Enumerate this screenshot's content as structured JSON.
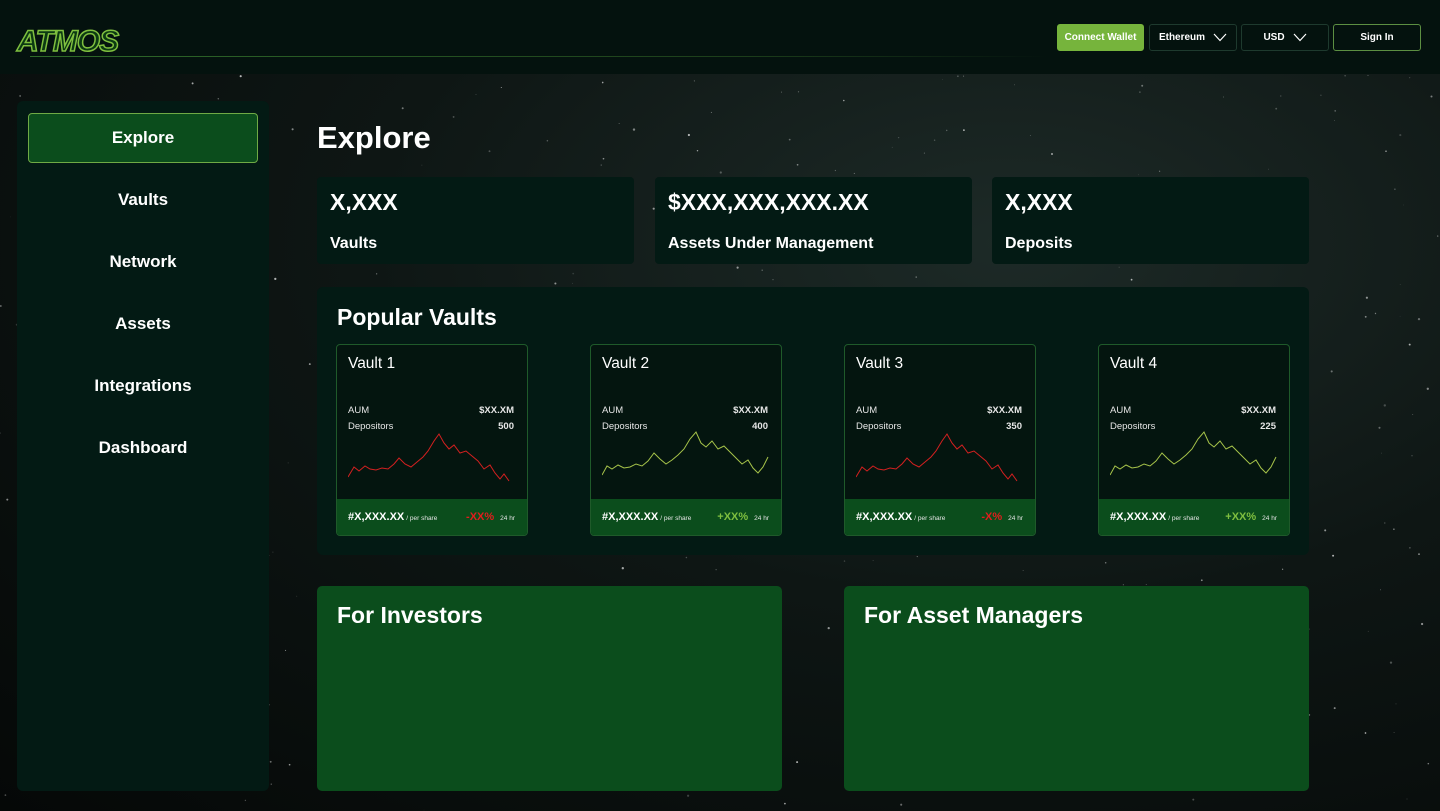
{
  "header": {
    "logo_text": "ATMOS",
    "connect_label": "Connect Wallet",
    "network": "Ethereum",
    "currency": "USD",
    "signin_label": "Sign In"
  },
  "sidebar": {
    "items": [
      {
        "label": "Explore",
        "active": true
      },
      {
        "label": "Vaults"
      },
      {
        "label": "Network"
      },
      {
        "label": "Assets"
      },
      {
        "label": "Integrations"
      },
      {
        "label": "Dashboard"
      }
    ]
  },
  "main": {
    "title": "Explore",
    "stats": [
      {
        "value": "X,XXX",
        "label": "Vaults"
      },
      {
        "value": "$XXX,XXX,XXX.XX",
        "label": "Assets Under Management"
      },
      {
        "value": "X,XXX",
        "label": "Deposits"
      }
    ],
    "popular": {
      "title": "Popular Vaults",
      "aum_label": "AUM",
      "depositors_label": "Depositors",
      "per_share_label": "/ per share",
      "period_label": "24 hr",
      "vaults": [
        {
          "name": "Vault 1",
          "aum": "$XX.XM",
          "depositors": "500",
          "price": "#X,XXX.XX",
          "change": "-XX%",
          "trend": "negative"
        },
        {
          "name": "Vault 2",
          "aum": "$XX.XM",
          "depositors": "400",
          "price": "#X,XXX.XX",
          "change": "+XX%",
          "trend": "positive"
        },
        {
          "name": "Vault 3",
          "aum": "$XX.XM",
          "depositors": "350",
          "price": "#X,XXX.XX",
          "change": "-X%",
          "trend": "negative"
        },
        {
          "name": "Vault 4",
          "aum": "$XX.XM",
          "depositors": "225",
          "price": "#X,XXX.XX",
          "change": "+XX%",
          "trend": "positive"
        }
      ]
    },
    "investors_title": "For Investors",
    "managers_title": "For Asset Managers"
  },
  "colors": {
    "accent_green": "#76b43c",
    "dark_green": "#0b4d1c",
    "negative": "#e11d1d",
    "positive_line": "#a7c44a",
    "negative_line": "#d42020"
  },
  "icons": {
    "dropdown": "chevron-down-icon"
  }
}
